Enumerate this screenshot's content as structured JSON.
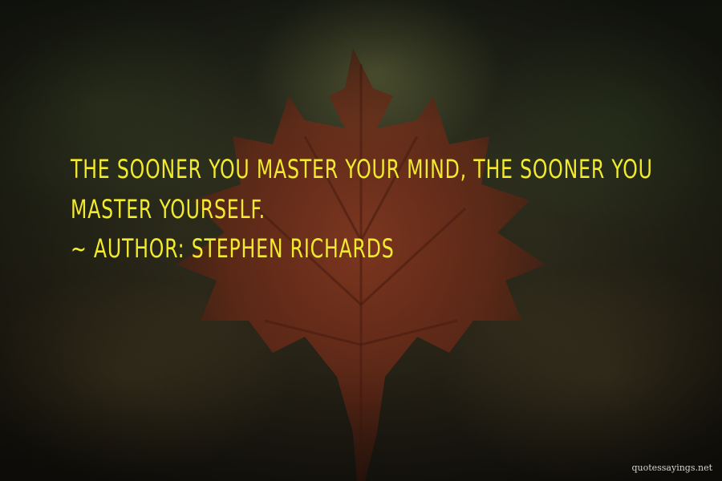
{
  "quote": {
    "text": "THE SOONER YOU MASTER YOUR MIND, THE SOONER YOU MASTER YOURSELF.",
    "tilde": "~",
    "author_prefix": "AUTHOR:",
    "author_name": "STEPHEN RICHARDS"
  },
  "watermark": "quotessayings.net",
  "colors": {
    "text": "#f2ea2e",
    "leaf": "#7a2e1c"
  }
}
